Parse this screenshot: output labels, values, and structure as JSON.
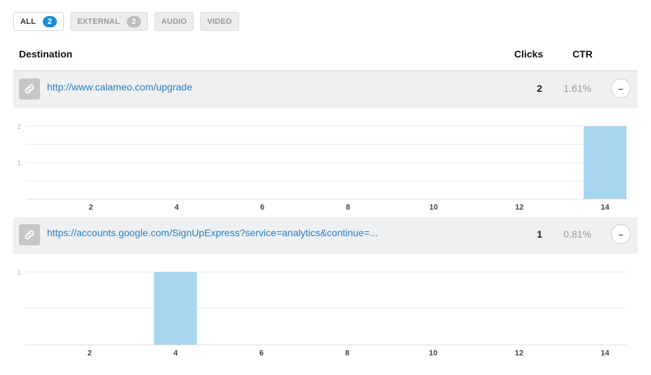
{
  "filters": [
    {
      "label": "ALL",
      "count": "2",
      "active": true
    },
    {
      "label": "EXTERNAL",
      "count": "2",
      "active": false
    },
    {
      "label": "AUDIO",
      "count": "",
      "active": false
    },
    {
      "label": "VIDEO",
      "count": "",
      "active": false
    }
  ],
  "table": {
    "col_destination": "Destination",
    "col_clicks": "Clicks",
    "col_ctr": "CTR"
  },
  "rows": [
    {
      "url": "http://www.calameo.com/upgrade",
      "clicks": "2",
      "ctr": "1.61%",
      "toggle_label": "–"
    },
    {
      "url": "https://accounts.google.com/SignUpExpress?service=analytics&continue=...",
      "clicks": "1",
      "ctr": "0.81%",
      "toggle_label": "–"
    }
  ],
  "icons": {
    "link": "link-icon"
  },
  "colors": {
    "accent": "#1a8ed6",
    "bar": "#a8d6f0",
    "link": "#2a7ec2"
  },
  "chart_data": [
    {
      "type": "bar",
      "x": [
        1,
        2,
        3,
        4,
        5,
        6,
        7,
        8,
        9,
        10,
        11,
        12,
        13,
        14
      ],
      "values": [
        0,
        0,
        0,
        0,
        0,
        0,
        0,
        0,
        0,
        0,
        0,
        0,
        0,
        2
      ],
      "xticks": [
        2,
        4,
        6,
        8,
        10,
        12,
        14
      ],
      "yticks": [
        1,
        2
      ],
      "ylim": [
        0,
        2
      ],
      "grid": true
    },
    {
      "type": "bar",
      "x": [
        1,
        2,
        3,
        4,
        5,
        6,
        7,
        8,
        9,
        10,
        11,
        12,
        13,
        14
      ],
      "values": [
        0,
        0,
        0,
        1,
        0,
        0,
        0,
        0,
        0,
        0,
        0,
        0,
        0,
        0
      ],
      "xticks": [
        2,
        4,
        6,
        8,
        10,
        12,
        14
      ],
      "yticks": [
        1
      ],
      "ylim": [
        0,
        1
      ],
      "grid": true
    }
  ]
}
